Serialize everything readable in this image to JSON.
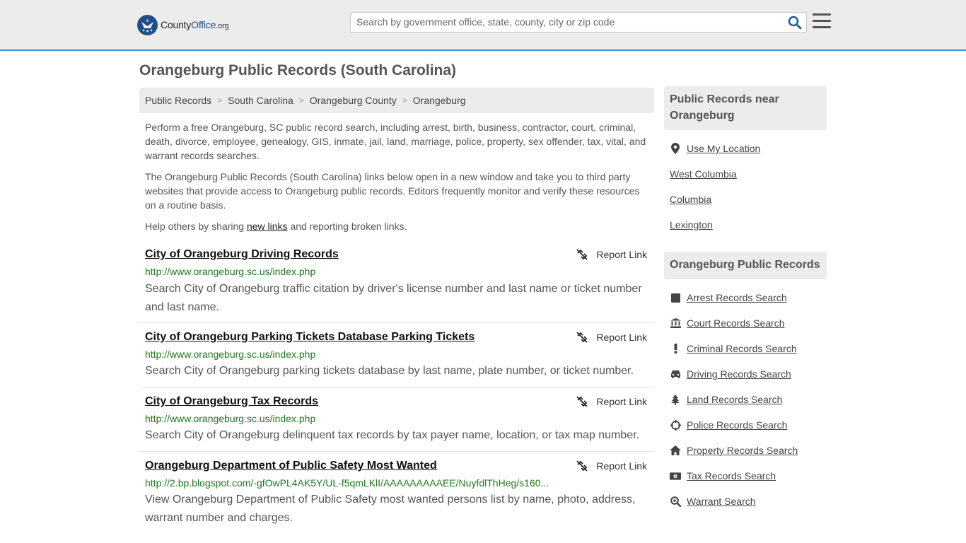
{
  "header": {
    "logo": {
      "brand": "County",
      "brand_accent": "Office",
      "tld": ".org"
    },
    "search": {
      "placeholder": "Search by government office, state, county, city or zip code"
    }
  },
  "page": {
    "title": "Orangeburg Public Records (South Carolina)"
  },
  "breadcrumb": [
    "Public Records",
    "South Carolina",
    "Orangeburg County",
    "Orangeburg"
  ],
  "intro": {
    "p1": "Perform a free Orangeburg, SC public record search, including arrest, birth, business, contractor, court, criminal, death, divorce, employee, genealogy, GIS, inmate, jail, land, marriage, police, property, sex offender, tax, vital, and warrant records searches.",
    "p2": "The Orangeburg Public Records (South Carolina) links below open in a new window and take you to third party websites that provide access to Orangeburg public records. Editors frequently monitor and verify these resources on a routine basis.",
    "p3_before": "Help others by sharing ",
    "p3_link": "new links",
    "p3_after": " and reporting broken links."
  },
  "records": [
    {
      "title": "City of Orangeburg Driving Records",
      "url": "http://www.orangeburg.sc.us/index.php",
      "desc": "Search City of Orangeburg traffic citation by driver's license number and last name or ticket number and last name.",
      "report": "Report Link"
    },
    {
      "title": "City of Orangeburg Parking Tickets Database Parking Tickets",
      "url": "http://www.orangeburg.sc.us/index.php",
      "desc": "Search City of Orangeburg parking tickets database by last name, plate number, or ticket number.",
      "report": "Report Link"
    },
    {
      "title": "City of Orangeburg Tax Records",
      "url": "http://www.orangeburg.sc.us/index.php",
      "desc": "Search City of Orangeburg delinquent tax records by tax payer name, location, or tax map number.",
      "report": "Report Link"
    },
    {
      "title": "Orangeburg Department of Public Safety Most Wanted",
      "url": "http://2.bp.blogspot.com/-gfOwPL4AK5Y/UL-f5qmLKlI/AAAAAAAAAEE/NuyfdlThHeg/s160...",
      "desc": "View Orangeburg Department of Public Safety most wanted persons list by name, photo, address, warrant number and charges.",
      "report": "Report Link"
    }
  ],
  "sidebar": {
    "near": {
      "heading": "Public Records near Orangeburg",
      "use_location": "Use My Location",
      "cities": [
        "West Columbia",
        "Columbia",
        "Lexington"
      ]
    },
    "records": {
      "heading": "Orangeburg Public Records",
      "links": [
        {
          "label": "Arrest Records Search",
          "icon": "square-icon"
        },
        {
          "label": "Court Records Search",
          "icon": "courthouse-icon"
        },
        {
          "label": "Criminal Records Search",
          "icon": "exclamation-icon"
        },
        {
          "label": "Driving Records Search",
          "icon": "car-icon"
        },
        {
          "label": "Land Records Search",
          "icon": "tree-icon"
        },
        {
          "label": "Police Records Search",
          "icon": "crosshair-icon"
        },
        {
          "label": "Property Records Search",
          "icon": "home-icon"
        },
        {
          "label": "Tax Records Search",
          "icon": "money-icon"
        },
        {
          "label": "Warrant Search",
          "icon": "magnifier-icon"
        }
      ]
    }
  },
  "colors": {
    "accent_border": "#3e8ed0",
    "url_green": "#217821",
    "logo_blue": "#1f4f86",
    "panel_gray": "#ececec"
  }
}
